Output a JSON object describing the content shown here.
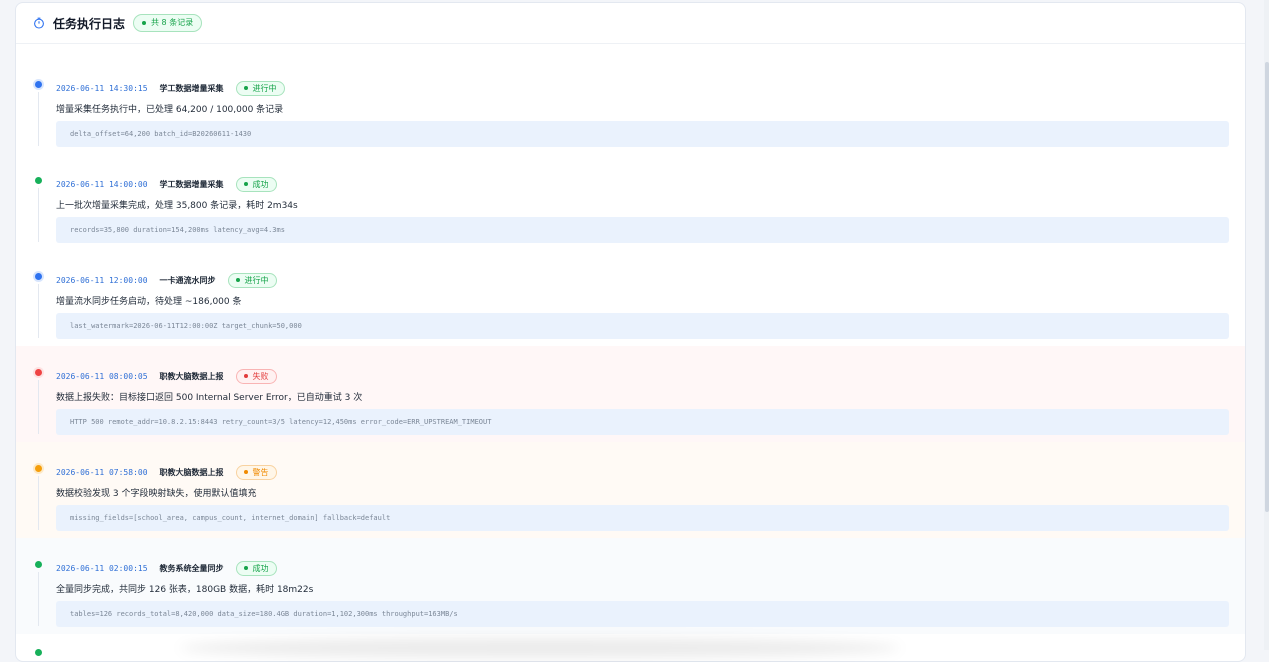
{
  "header": {
    "title": "任务执行日志",
    "count_badge": "共 8 条记录"
  },
  "colors": {
    "running": "#2f73f0",
    "success": "#17b05a",
    "failed": "#ef4444",
    "warning": "#f59e0b",
    "timestamp": "#2f6fd6"
  },
  "entries": [
    {
      "timestamp": "2026-06-11 14:30:15",
      "task": "学工数据增量采集",
      "status_type": "running",
      "status": "进行中",
      "message": "增量采集任务执行中，已处理 64,200 / 100,000 条记录",
      "detail": "delta_offset=64,200 batch_id=B20260611-1430"
    },
    {
      "timestamp": "2026-06-11 14:00:00",
      "task": "学工数据增量采集",
      "status_type": "success",
      "status": "成功",
      "message": "上一批次增量采集完成，处理 35,800 条记录，耗时 2m34s",
      "detail": "records=35,800 duration=154,200ms latency_avg=4.3ms"
    },
    {
      "timestamp": "2026-06-11 12:00:00",
      "task": "一卡通流水同步",
      "status_type": "running",
      "status": "进行中",
      "message": "增量流水同步任务启动，待处理 ~186,000 条",
      "detail": "last_watermark=2026-06-11T12:00:00Z target_chunk=50,000"
    },
    {
      "timestamp": "2026-06-11 08:00:05",
      "task": "职教大脑数据上报",
      "status_type": "failed",
      "status": "失败",
      "message": "数据上报失败：目标接口返回 500 Internal Server Error，已自动重试 3 次",
      "detail": "HTTP 500 remote_addr=10.8.2.15:8443 retry_count=3/5 latency=12,450ms error_code=ERR_UPSTREAM_TIMEOUT"
    },
    {
      "timestamp": "2026-06-11 07:58:00",
      "task": "职教大脑数据上报",
      "status_type": "warning",
      "status": "警告",
      "message": "数据校验发现 3 个字段映射缺失，使用默认值填充",
      "detail": "missing_fields=[school_area, campus_count, internet_domain] fallback=default"
    },
    {
      "timestamp": "2026-06-11 02:00:15",
      "task": "教务系统全量同步",
      "status_type": "success",
      "status": "成功",
      "message": "全量同步完成，共同步 126 张表，180GB 数据，耗时 18m22s",
      "detail": "tables=126 records_total=8,420,000 data_size=180.4GB duration=1,102,300ms throughput=163MB/s"
    }
  ]
}
